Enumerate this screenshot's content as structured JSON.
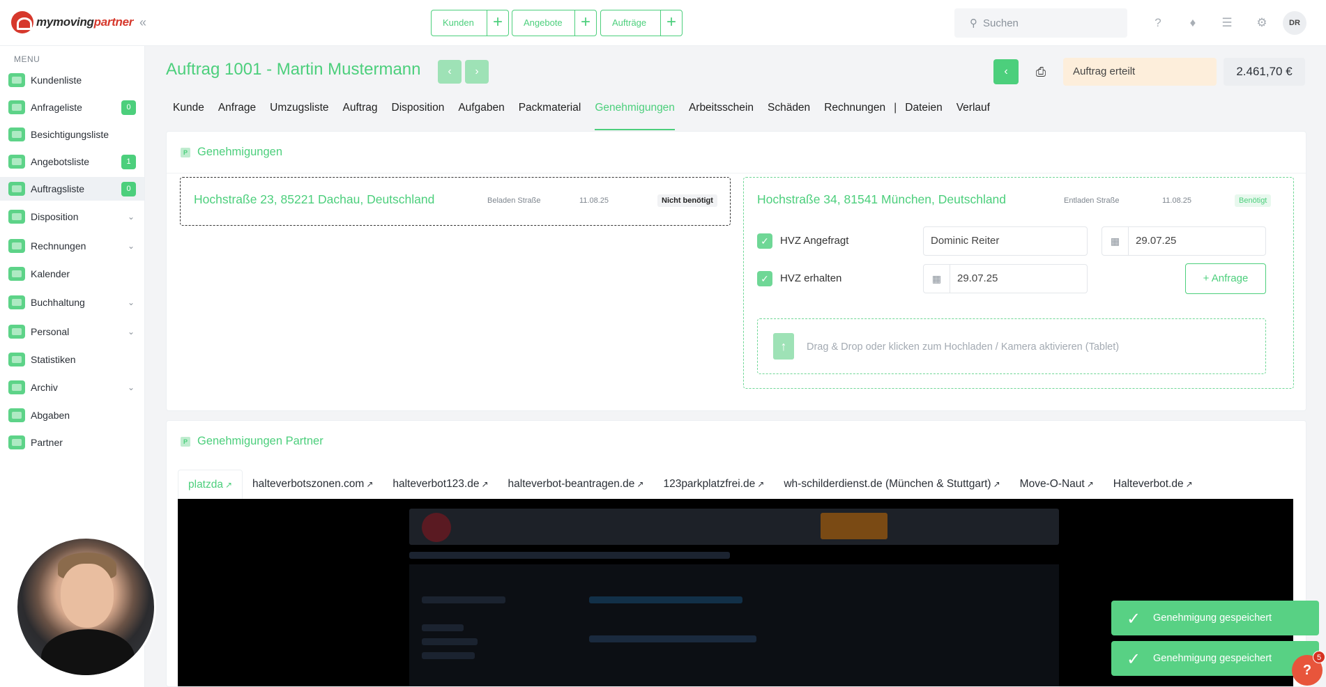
{
  "brand": {
    "name_prefix": "my",
    "name_mid": "moving",
    "name_suffix": "partner"
  },
  "topbar": {
    "quick": [
      {
        "label": "Kunden"
      },
      {
        "label": "Angebote"
      },
      {
        "label": "Aufträge"
      }
    ],
    "plus": "+",
    "search_placeholder": "Suchen",
    "avatar": "DR",
    "icons": [
      "help-icon",
      "bell-icon",
      "checklist-icon",
      "gear-icon"
    ]
  },
  "sidebar": {
    "menu_label": "MENU",
    "items": [
      {
        "label": "Kundenliste"
      },
      {
        "label": "Anfrageliste",
        "badge": "0"
      },
      {
        "label": "Besichtigungsliste"
      },
      {
        "label": "Angebotsliste",
        "badge": "1"
      },
      {
        "label": "Auftragsliste",
        "badge": "0"
      },
      {
        "label": "Disposition"
      },
      {
        "label": "Rechnungen"
      },
      {
        "label": "Kalender"
      },
      {
        "label": "Buchhaltung"
      },
      {
        "label": "Personal"
      },
      {
        "label": "Statistiken"
      },
      {
        "label": "Archiv"
      },
      {
        "label": "Abgaben"
      },
      {
        "label": "Partner"
      }
    ]
  },
  "header": {
    "title": "Auftrag 1001 - Martin Mustermann",
    "status": "Auftrag erteilt",
    "amount": "2.461,70 €"
  },
  "tabs": [
    {
      "label": "Kunde"
    },
    {
      "label": "Anfrage"
    },
    {
      "label": "Umzugsliste"
    },
    {
      "label": "Auftrag"
    },
    {
      "label": "Disposition"
    },
    {
      "label": "Aufgaben"
    },
    {
      "label": "Packmaterial"
    },
    {
      "label": "Genehmigungen"
    },
    {
      "label": "Arbeitsschein"
    },
    {
      "label": "Schäden"
    },
    {
      "label": "Rechnungen"
    },
    {
      "label": "|"
    },
    {
      "label": "Dateien"
    },
    {
      "label": "Verlauf"
    }
  ],
  "genehmigungen": {
    "title": "Genehmigungen",
    "left": {
      "address": "Hochstraße 23, 85221 Dachau, Deutschland",
      "type": "Beladen Straße",
      "date": "11.08.25",
      "status": "Nicht benötigt"
    },
    "right": {
      "address": "Hochstraße 34, 81541 München, Deutschland",
      "type": "Entladen Straße",
      "date": "11.08.25",
      "status": "Benötigt",
      "hvz_requested_label": "HVZ Angefragt",
      "requested_by": "Dominic Reiter",
      "requested_date": "29.07.25",
      "hvz_received_label": "HVZ erhalten",
      "received_date": "29.07.25",
      "anfrage_button": "+ Anfrage",
      "upload_text": "Drag & Drop oder klicken zum Hochladen / Kamera aktivieren (Tablet)"
    }
  },
  "partner": {
    "title": "Genehmigungen Partner",
    "tabs": [
      {
        "label": "platzda"
      },
      {
        "label": "halteverbotszonen.com"
      },
      {
        "label": "halteverbot123.de"
      },
      {
        "label": "halteverbot-beantragen.de"
      },
      {
        "label": "123parkplatzfrei.de"
      },
      {
        "label": "wh-schilderdienst.de (München & Stuttgart)"
      },
      {
        "label": "Move-O-Naut"
      },
      {
        "label": "Halteverbot.de"
      }
    ]
  },
  "toasts": [
    {
      "text": "Genehmigung gespeichert"
    },
    {
      "text": "Genehmigung gespeichert"
    }
  ],
  "help": {
    "label": "?",
    "count": "5"
  },
  "colors": {
    "accent": "#4ccf7c",
    "status_bg": "#fdeedb",
    "danger": "#e8553b"
  }
}
